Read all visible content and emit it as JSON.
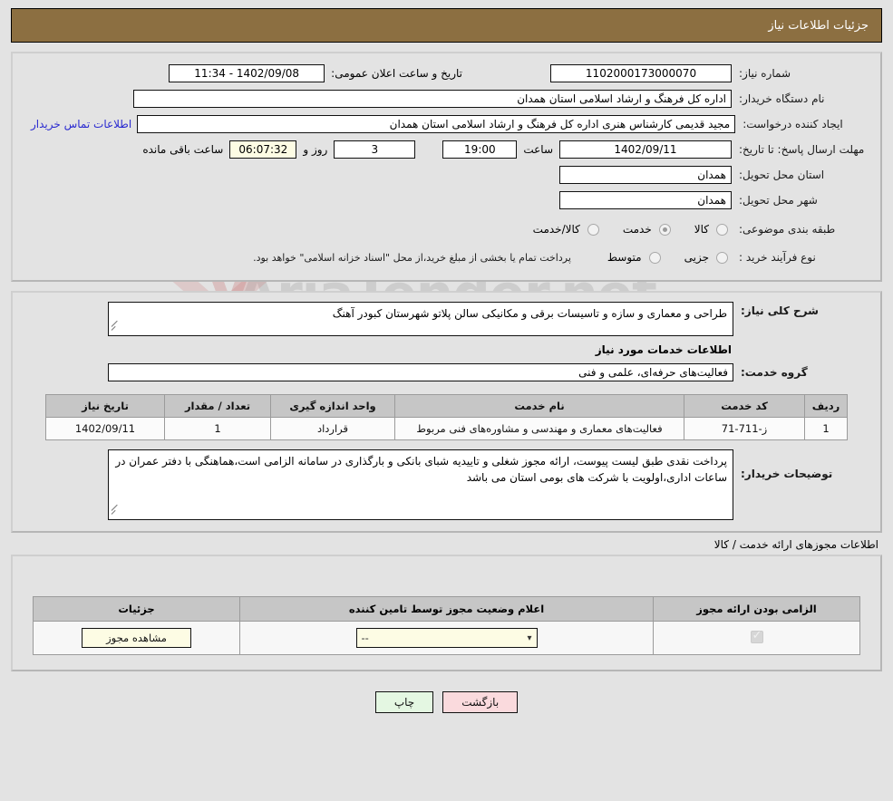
{
  "header": {
    "title": "جزئیات اطلاعات نیاز"
  },
  "main_info": {
    "need_number_label": "شماره نیاز:",
    "need_number_value": "1102000173000070",
    "announce_label": "تاریخ و ساعت اعلان عمومی:",
    "announce_value": "1402/09/08 - 11:34",
    "buyer_org_label": "نام دستگاه خریدار:",
    "buyer_org_value": "اداره کل فرهنگ و ارشاد اسلامی استان همدان",
    "creator_label": "ایجاد کننده درخواست:",
    "creator_value": "مجید قدیمی کارشناس هنری اداره کل فرهنگ و ارشاد اسلامی استان همدان",
    "contact_link": "اطلاعات تماس خریدار",
    "deadline_label": "مهلت ارسال پاسخ: تا تاریخ:",
    "deadline_date": "1402/09/11",
    "deadline_hour_label": "ساعت",
    "deadline_hour": "19:00",
    "days_remaining": "3",
    "days_label": "روز و",
    "time_remaining": "06:07:32",
    "time_remaining_label": "ساعت باقی مانده",
    "province_label": "استان محل تحویل:",
    "province_value": "همدان",
    "city_label": "شهر محل تحویل:",
    "city_value": "همدان",
    "category_label": "طبقه بندی موضوعی:",
    "category_options": [
      {
        "label": "کالا",
        "selected": false
      },
      {
        "label": "خدمت",
        "selected": true
      },
      {
        "label": "کالا/خدمت",
        "selected": false
      }
    ],
    "process_label": "نوع فرآیند خرید :",
    "process_options": [
      {
        "label": "جزیی",
        "selected": false
      },
      {
        "label": "متوسط",
        "selected": false
      }
    ],
    "process_note": "پرداخت تمام یا بخشی از مبلغ خرید،از محل \"اسناد خزانه اسلامی\" خواهد بود."
  },
  "description": {
    "label": "شرح کلی نیاز:",
    "value": "طراحی و معماری و سازه و تاسیسات برقی و مکانیکی سالن پلاتو شهرستان کبودر آهنگ"
  },
  "services": {
    "section_title": "اطلاعات خدمات مورد نیاز",
    "group_label": "گروه خدمت:",
    "group_value": "فعالیت‌های حرفه‌ای، علمی و فنی",
    "columns": [
      "ردیف",
      "کد خدمت",
      "نام خدمت",
      "واحد اندازه گیری",
      "تعداد / مقدار",
      "تاریخ نیاز"
    ],
    "rows": [
      {
        "index": "1",
        "code": "ز-711-71",
        "name": "فعالیت‌های معماری و مهندسی و مشاوره‌های فنی مربوط",
        "unit": "قرارداد",
        "quantity": "1",
        "need_date": "1402/09/11"
      }
    ]
  },
  "buyer_notes": {
    "label": "توضیحات خریدار:",
    "value": "پرداخت نقدی طبق لیست پیوست، ارائه مجوز شغلی و تاییدیه شبای بانکی و بارگذاری در سامانه الزامی است،هماهنگی با دفتر عمران در ساعات اداری،اولویت با شرکت های بومی استان می باشد"
  },
  "permits": {
    "section_label": "اطلاعات مجوزهای ارائه خدمت / کالا",
    "columns": [
      "الزامی بودن ارائه مجوز",
      "اعلام وضعیت مجوز توسط تامین کننده",
      "جزئیات"
    ],
    "rows": [
      {
        "required_checked": true,
        "status_value": "--",
        "details_button": "مشاهده مجوز"
      }
    ]
  },
  "footer": {
    "back_button": "بازگشت",
    "print_button": "چاپ"
  },
  "watermark": {
    "text": "AriaTender.net"
  }
}
